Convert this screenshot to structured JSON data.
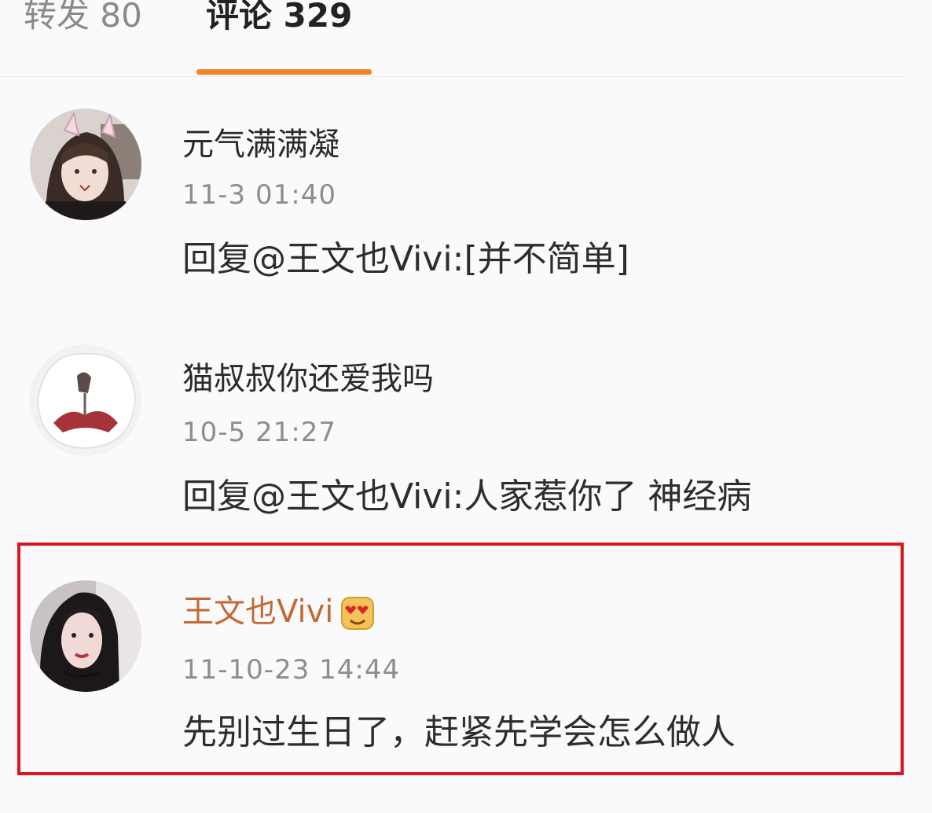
{
  "tabs": {
    "repost": {
      "label": "转发 80"
    },
    "comments": {
      "label": "评论 329",
      "active": true
    },
    "active_color": "#f0852b"
  },
  "comments": [
    {
      "username": "元气满满凝",
      "timestamp": "11-3 01:40",
      "text": "回复@王文也Vivi:[并不简单]"
    },
    {
      "username": "猫叔叔你还爱我吗",
      "timestamp": "10-5 21:27",
      "text": "回复@王文也Vivi:人家惹你了 神经病"
    },
    {
      "username": "王文也Vivi",
      "username_color": "#c26a32",
      "badge_icon": "heart-eyes-emoji-icon",
      "timestamp": "11-10-23 14:44",
      "text": "先别过生日了，赶紧先学会怎么做人",
      "highlight_color": "#d8161d"
    }
  ]
}
